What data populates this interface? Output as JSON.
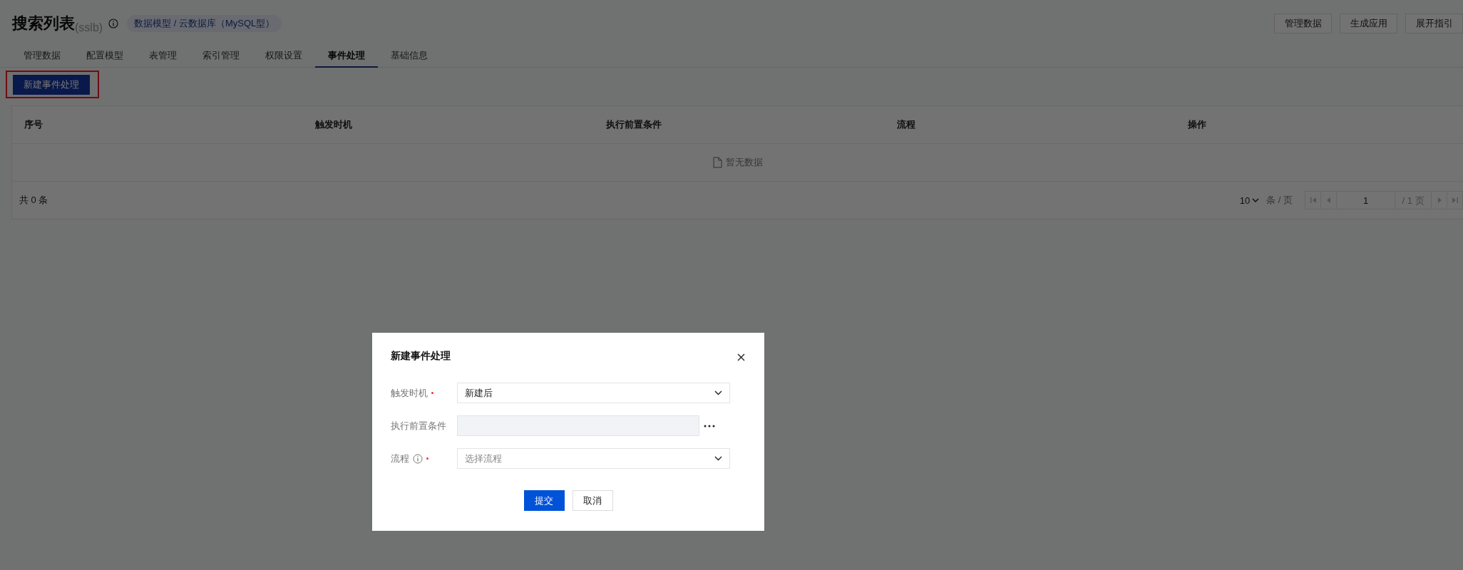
{
  "header": {
    "title": "搜索列表",
    "subtitle": "(sslb)",
    "breadcrumb": "数据模型 / 云数据库（MySQL型）",
    "actions": [
      "管理数据",
      "生成应用",
      "展开指引"
    ]
  },
  "tabs": [
    {
      "label": "管理数据",
      "selected": false
    },
    {
      "label": "配置模型",
      "selected": false
    },
    {
      "label": "表管理",
      "selected": false
    },
    {
      "label": "索引管理",
      "selected": false
    },
    {
      "label": "权限设置",
      "selected": false
    },
    {
      "label": "事件处理",
      "selected": true
    },
    {
      "label": "基础信息",
      "selected": false
    }
  ],
  "toolbar": {
    "primary_button": "新建事件处理",
    "highlighted": true
  },
  "table": {
    "columns": [
      "序号",
      "触发时机",
      "执行前置条件",
      "流程",
      "操作"
    ],
    "empty_text": "暂无数据"
  },
  "pagination": {
    "total": "共 0 条",
    "page_size": "10",
    "page_size_unit": "条 / 页",
    "page": "1",
    "page_total": "/ 1 页"
  },
  "dialog": {
    "title": "新建事件处理",
    "fields": [
      {
        "label": "触发时机",
        "kind": "select",
        "required": true,
        "info": false,
        "value": "新建后"
      },
      {
        "label": "执行前置条件",
        "kind": "readonly",
        "required": false,
        "info": false
      },
      {
        "label": "流程",
        "kind": "select",
        "required": true,
        "info": true,
        "placeholder": "选择流程"
      }
    ],
    "buttons": [
      {
        "label": "提交",
        "primary": true
      },
      {
        "label": "取消",
        "primary": false
      }
    ]
  }
}
